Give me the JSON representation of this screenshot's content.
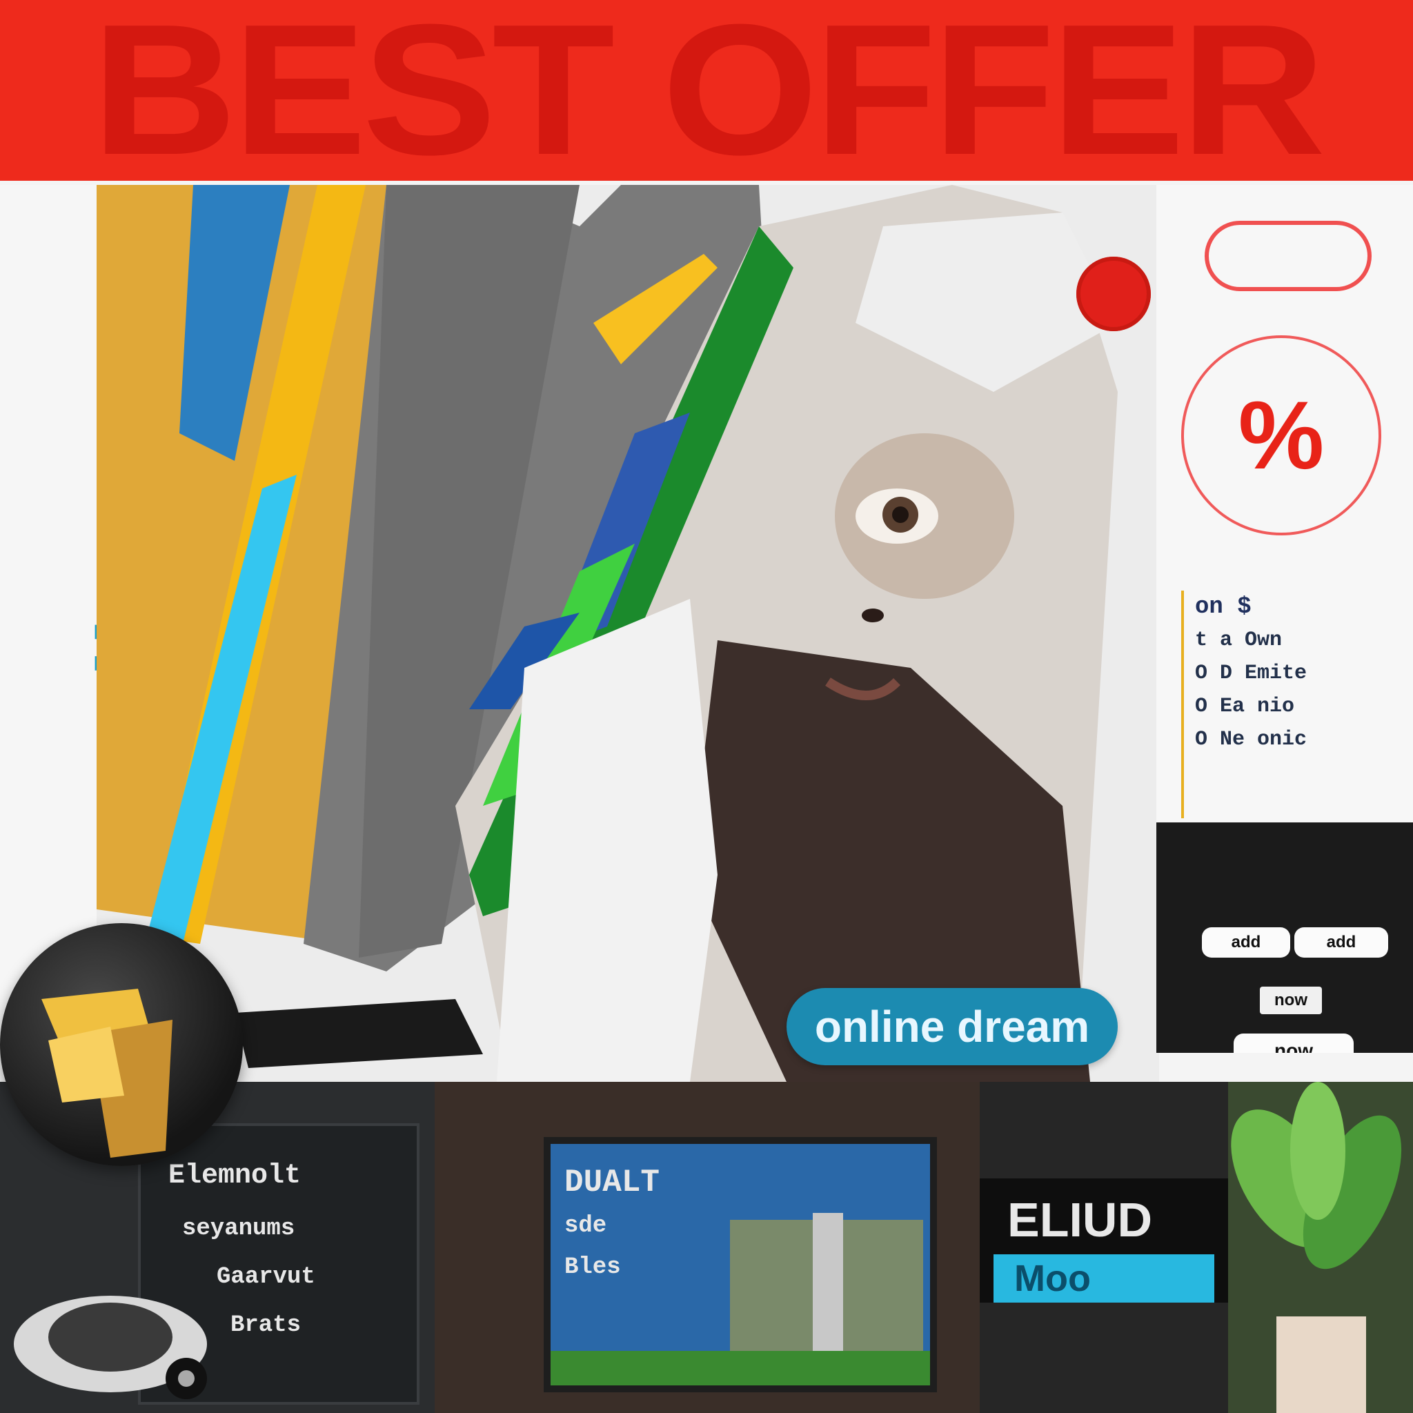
{
  "banner": {
    "title": "BEST OFFER"
  },
  "hero": {
    "vertical_text": "Adipacy",
    "cta_label": "online dream"
  },
  "panel": {
    "percent_symbol": "%",
    "list": [
      "on $",
      "t a Own",
      "O D Emite",
      "O Ea nio",
      "O Ne onic"
    ],
    "button_main": "now",
    "button_left": "add",
    "button_right": "add",
    "label_small": "now"
  },
  "strip": {
    "tile1_lines": [
      "Elemnolt",
      "seyanums",
      "Gaarvut",
      "Brats"
    ],
    "tile2_lines": [
      "DUALT",
      "sde",
      "Bles"
    ],
    "tile3_title": "ELIUD",
    "tile3_sub": "Moo"
  },
  "colors": {
    "banner_red": "#ee2a1c",
    "accent_blue": "#1c8bb1",
    "accent_red": "#e82318"
  }
}
